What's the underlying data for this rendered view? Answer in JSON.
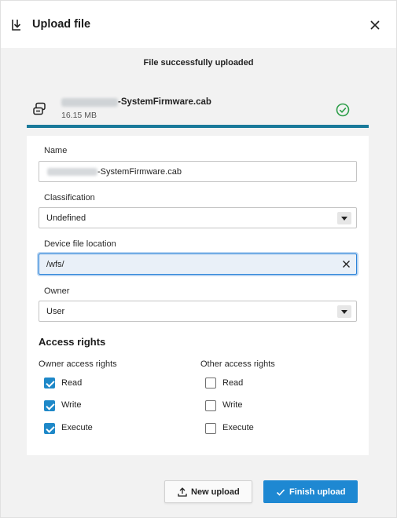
{
  "dialog": {
    "title": "Upload file",
    "close_icon": "close-icon",
    "header_icon": "upload-import-icon"
  },
  "status_text": "File successfully uploaded",
  "file": {
    "name": "-SystemFirmware.cab",
    "size": "16.15 MB",
    "type_icon": "firmware-file-icon",
    "status_icon": "check-circle-icon",
    "accent_color": "#1a7a9a"
  },
  "form": {
    "name": {
      "label": "Name",
      "value": "-SystemFirmware.cab"
    },
    "classification": {
      "label": "Classification",
      "value": "Undefined"
    },
    "location": {
      "label": "Device file location",
      "value": "/wfs/"
    },
    "owner": {
      "label": "Owner",
      "value": "User"
    }
  },
  "access": {
    "title": "Access rights",
    "owner": {
      "label": "Owner access rights",
      "read": {
        "label": "Read",
        "checked": true
      },
      "write": {
        "label": "Write",
        "checked": true
      },
      "execute": {
        "label": "Execute",
        "checked": true
      }
    },
    "other": {
      "label": "Other access rights",
      "read": {
        "label": "Read",
        "checked": false
      },
      "write": {
        "label": "Write",
        "checked": false
      },
      "execute": {
        "label": "Execute",
        "checked": false
      }
    }
  },
  "buttons": {
    "new_upload": "New upload",
    "finish_upload": "Finish upload",
    "primary_color": "#1e88d2"
  }
}
